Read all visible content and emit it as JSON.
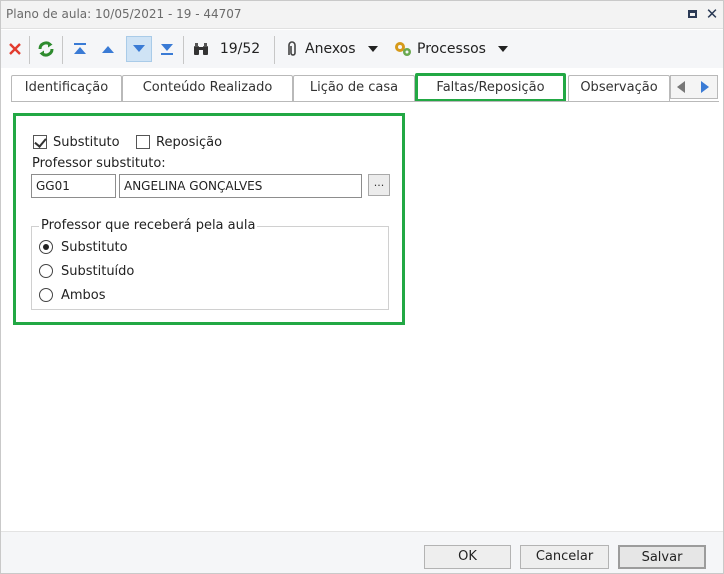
{
  "window": {
    "title": "Plano de aula: 10/05/2021 - 19 - 44707"
  },
  "toolbar": {
    "record_counter": "19/52",
    "attachments_label": "Anexos",
    "processes_label": "Processos"
  },
  "tabs": [
    {
      "label": "Identificação",
      "active": false
    },
    {
      "label": "Conteúdo Realizado",
      "active": false
    },
    {
      "label": "Lição de casa",
      "active": false
    },
    {
      "label": "Faltas/Reposição",
      "active": true
    },
    {
      "label": "Observação",
      "active": false
    }
  ],
  "form": {
    "substituto_label": "Substituto",
    "substituto_checked": true,
    "reposicao_label": "Reposição",
    "reposicao_checked": false,
    "professor_substituto_label": "Professor substituto:",
    "professor_code": "GG01",
    "professor_name": "ANGELINA GONÇALVES",
    "lookup_label": "...",
    "payment_group": {
      "legend": "Professor que receberá pela aula",
      "options": [
        {
          "label": "Substituto",
          "selected": true
        },
        {
          "label": "Substituído",
          "selected": false
        },
        {
          "label": "Ambos",
          "selected": false
        }
      ]
    }
  },
  "buttons": {
    "ok": "OK",
    "cancel": "Cancelar",
    "save": "Salvar"
  },
  "colors": {
    "highlight": "#22a844",
    "refresh_icon": "#2e8b2e",
    "close_icon": "#e23b2e",
    "nav_icon": "#3a7bd5"
  }
}
